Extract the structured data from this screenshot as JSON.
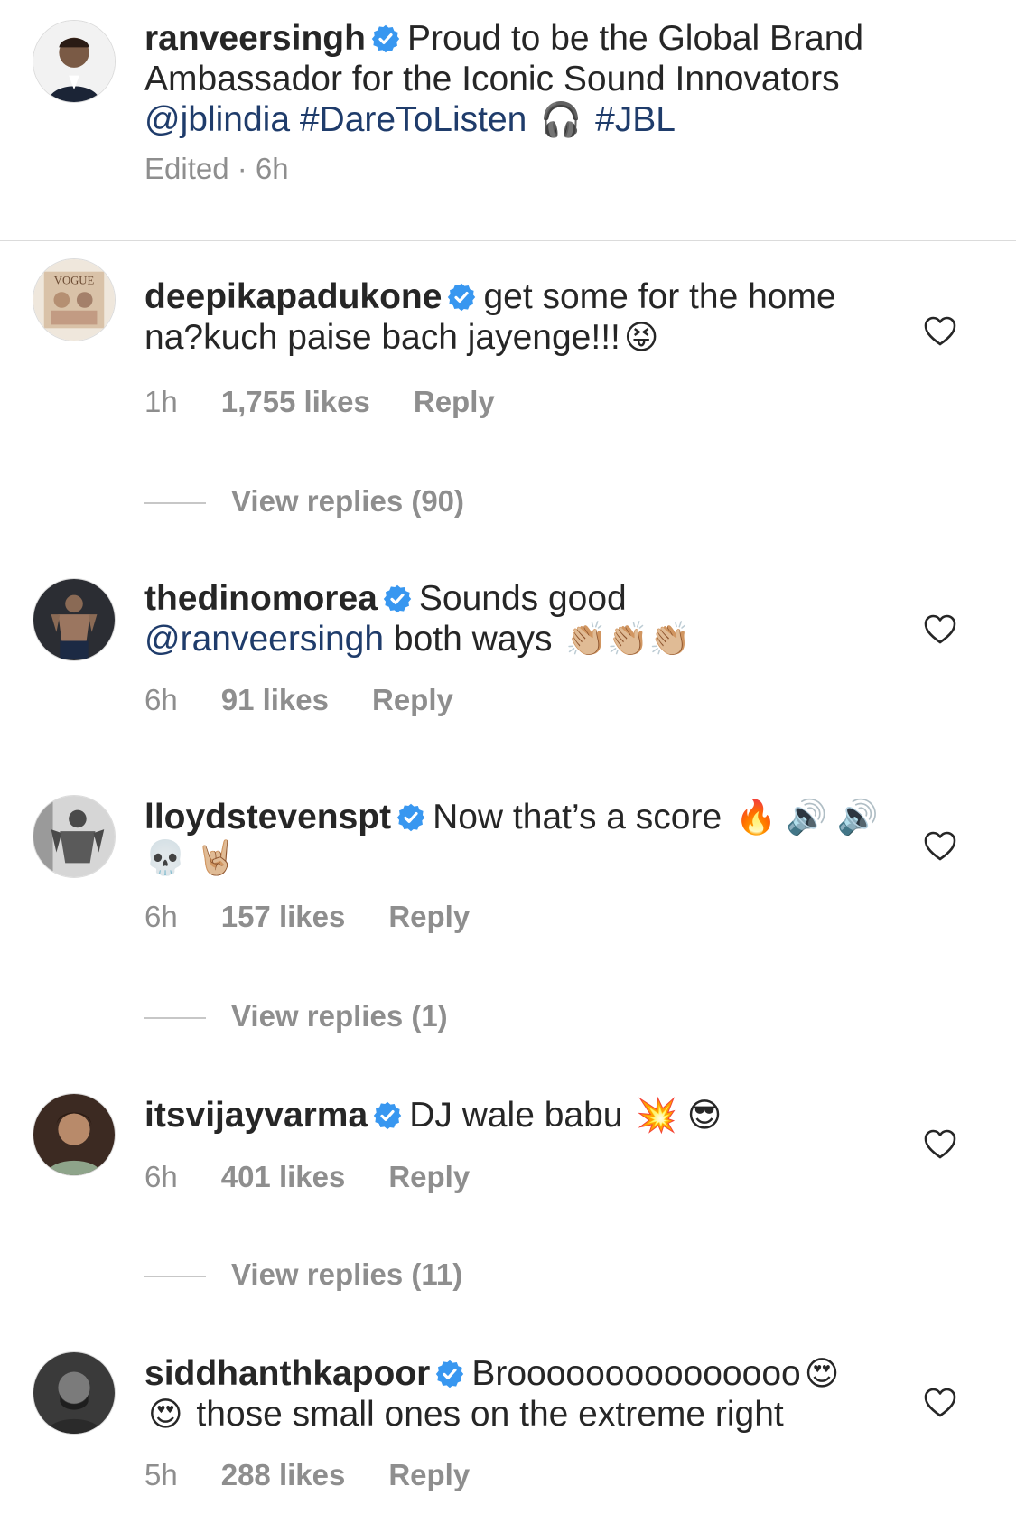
{
  "caption": {
    "username": "ranveersingh",
    "text": "Proud to be the Global Brand Ambassador for the Iconic Sound Innovators",
    "mention": "@jblindia",
    "tag1": "#DareToListen",
    "emoji": "🎧",
    "tag2": "#JBL",
    "meta": "Edited · 6h"
  },
  "comments": [
    {
      "username": "deepikapadukone",
      "text": "get some for the home na?kuch paise bach jayenge!!!",
      "emoji": "😝",
      "time": "1h",
      "likes": "1,755 likes",
      "reply": "Reply",
      "view_replies": "View replies (90)"
    },
    {
      "username": "thedinomorea",
      "text": "Sounds good",
      "mention": "@ranveersingh",
      "text2": "both ways",
      "emoji": "👏🏼👏🏼👏🏼",
      "time": "6h",
      "likes": "91 likes",
      "reply": "Reply"
    },
    {
      "username": "lloydstevenspt",
      "text": "Now that’s a score",
      "emoji": "🔥 🔊 🔊 💀 🤘🏼",
      "time": "6h",
      "likes": "157 likes",
      "reply": "Reply",
      "view_replies": "View replies (1)"
    },
    {
      "username": "itsvijayvarma",
      "text": "DJ wale babu",
      "emoji": "💥 😎",
      "time": "6h",
      "likes": "401 likes",
      "reply": "Reply",
      "view_replies": "View replies (11)"
    },
    {
      "username": "siddhanthkapoor",
      "text": "Brooooooooooooooo",
      "emoji": "😍",
      "emoji2": "😍",
      "text2": "those small ones on the extreme right",
      "time": "5h",
      "likes": "288 likes",
      "reply": "Reply"
    }
  ],
  "colors": {
    "text": "#262626",
    "muted": "#8e8e8e",
    "link": "#1f3c6b",
    "verified": "#3897f0"
  },
  "icons": {
    "verified": "verified-badge-icon",
    "like": "heart-outline-icon"
  }
}
